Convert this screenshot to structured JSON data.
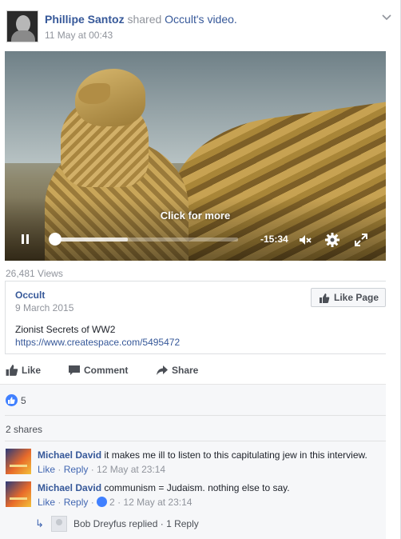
{
  "post": {
    "author": "Phillipe Santoz",
    "shared_text": "shared",
    "page_link": "Occult",
    "possessive": "'s",
    "video_word": "video.",
    "timestamp": "11 May at 00:43"
  },
  "video": {
    "overlay_text": "Click for more",
    "time_remaining": "-15:34",
    "progress_fraction": 0.4,
    "views": "26,481 Views"
  },
  "page_card": {
    "name": "Occult",
    "date": "9 March 2015",
    "like_page_label": "Like Page",
    "description": "Zionist Secrets of WW2",
    "link": "https://www.createspace.com/5495472"
  },
  "actions": {
    "like": "Like",
    "comment": "Comment",
    "share": "Share"
  },
  "reactions": {
    "count": "5"
  },
  "shares": "2 shares",
  "comments": [
    {
      "author": "Michael David",
      "text": "it makes me ill to listen to this capitulating jew in this interview.",
      "like": "Like",
      "reply": "Reply",
      "likes": "",
      "time": "12 May at 23:14"
    },
    {
      "author": "Michael David",
      "text": "communism = Judaism. nothing else to say.",
      "like": "Like",
      "reply": "Reply",
      "likes": "2",
      "time": "12 May at 23:14"
    }
  ],
  "reply_summary": {
    "name": "Bob Dreyfus",
    "text": "replied",
    "count": "1 Reply"
  },
  "colors": {
    "link": "#365899",
    "meta": "#90949c",
    "reaction": "#4080ff"
  }
}
